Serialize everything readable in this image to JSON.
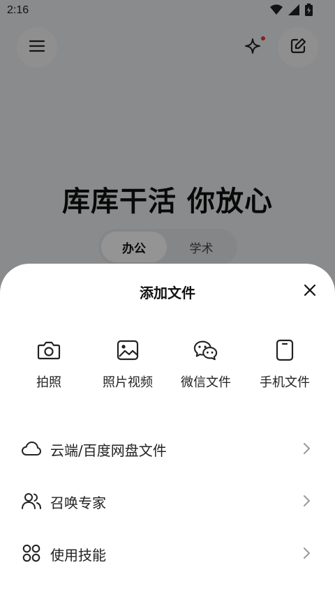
{
  "status": {
    "time": "2:16"
  },
  "background": {
    "headline": "库库干活 你放心",
    "tabs": [
      {
        "label": "办公",
        "active": true
      },
      {
        "label": "学术",
        "active": false
      }
    ]
  },
  "sheet": {
    "title": "添加文件",
    "sources": [
      {
        "icon": "camera-icon",
        "label": "拍照"
      },
      {
        "icon": "image-icon",
        "label": "照片视频"
      },
      {
        "icon": "wechat-icon",
        "label": "微信文件"
      },
      {
        "icon": "phone-icon",
        "label": "手机文件"
      }
    ],
    "rows": [
      {
        "icon": "cloud-icon",
        "label": "云端/百度网盘文件"
      },
      {
        "icon": "users-icon",
        "label": "召唤专家"
      },
      {
        "icon": "apps-icon",
        "label": "使用技能"
      }
    ]
  },
  "colors": {
    "accent_dot": "#e03a3a",
    "scrim": "rgba(0,0,0,0.42)"
  }
}
